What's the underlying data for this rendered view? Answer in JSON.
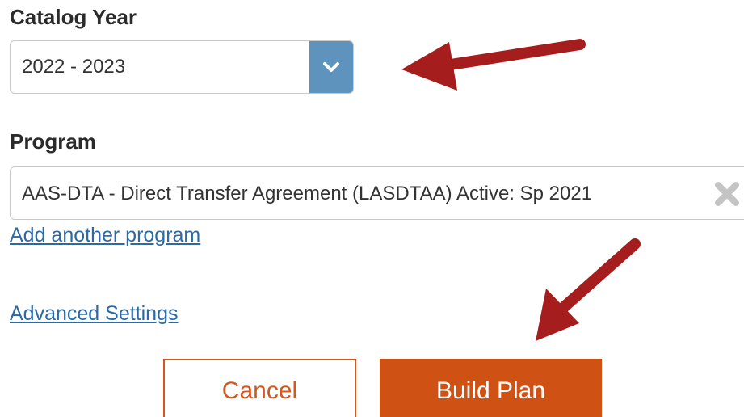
{
  "catalog_year": {
    "label": "Catalog Year",
    "selected": "2022 - 2023",
    "toggle_icon": "chevron-down-icon"
  },
  "program": {
    "label": "Program",
    "value": "AAS-DTA - Direct Transfer Agreement (LASDTAA) Active: Sp 2021",
    "clear_icon": "close-icon"
  },
  "links": {
    "add_program": "Add another program",
    "advanced_settings": "Advanced Settings"
  },
  "buttons": {
    "cancel": "Cancel",
    "build_plan": "Build Plan"
  },
  "colors": {
    "accent_orange": "#cf5114",
    "select_toggle_blue": "#5e93bd",
    "link_blue": "#2c6aa6",
    "annotation_arrow_red": "#a51d1d"
  }
}
